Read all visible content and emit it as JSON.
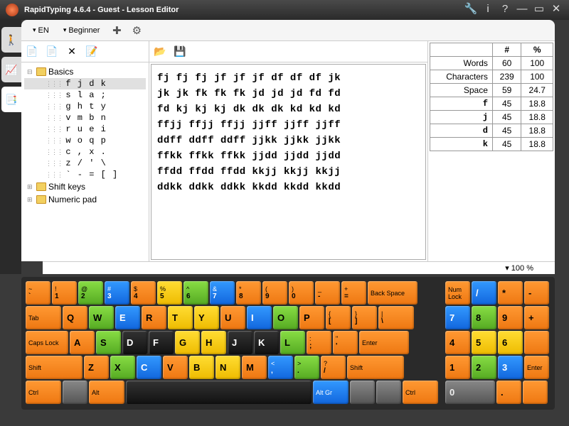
{
  "title": "RapidTyping 4.6.4 - Guest - Lesson Editor",
  "lang": "EN",
  "level": "Beginner",
  "tree": {
    "root": "Basics",
    "lessons": [
      "f j d k",
      "s l a ;",
      "g h t y",
      "v m b n",
      "r u e i",
      "w o q p",
      "c , x .",
      "z / ' \\",
      "` - = [ ]"
    ],
    "folders": [
      "Shift keys",
      "Numeric pad"
    ]
  },
  "text": [
    "fj fj fj jf jf jf df df df jk",
    "jk jk fk fk fk jd jd jd fd fd",
    "fd kj kj kj dk dk dk kd kd kd",
    "ffjj ffjj ffjj jjff jjff jjff",
    "ddff ddff ddff jjkk jjkk jjkk",
    "ffkk ffkk ffkk jjdd jjdd jjdd",
    "ffdd ffdd ffdd kkjj kkjj kkjj",
    "ddkk ddkk ddkk kkdd kkdd kkdd"
  ],
  "stats": {
    "head": [
      "#",
      "%"
    ],
    "rows": [
      {
        "label": "Words",
        "n": "60",
        "p": "100"
      },
      {
        "label": "Characters",
        "n": "239",
        "p": "100"
      },
      {
        "label": "Space",
        "n": "59",
        "p": "24.7"
      },
      {
        "label": "f",
        "n": "45",
        "p": "18.8",
        "bold": true
      },
      {
        "label": "j",
        "n": "45",
        "p": "18.8",
        "bold": true
      },
      {
        "label": "d",
        "n": "45",
        "p": "18.8",
        "bold": true
      },
      {
        "label": "k",
        "n": "45",
        "p": "18.8",
        "bold": true
      }
    ]
  },
  "zoom": "▾ 100 %",
  "keys": {
    "bs": "Back Space",
    "tab": "Tab",
    "caps": "Caps Lock",
    "enter": "Enter",
    "shift": "Shift",
    "ctrl": "Ctrl",
    "alt": "Alt",
    "altgr": "Alt Gr",
    "num": "Num Lock"
  }
}
